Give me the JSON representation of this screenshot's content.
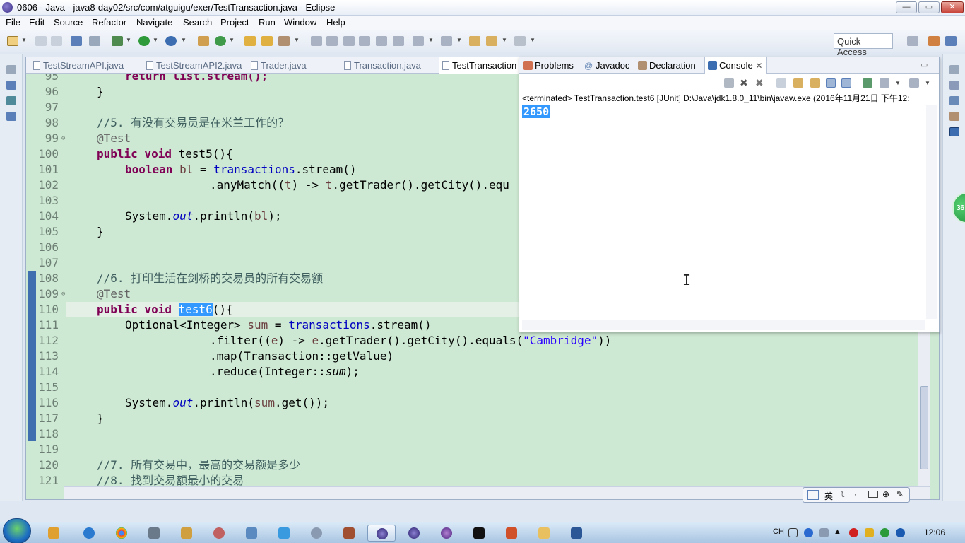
{
  "window": {
    "title": "0606 - Java - java8-day02/src/com/atguigu/exer/TestTransaction.java - Eclipse",
    "minimize_label": "—",
    "restore_label": "▭",
    "close_label": "✕"
  },
  "menu": [
    "File",
    "Edit",
    "Source",
    "Refactor",
    "Navigate",
    "Search",
    "Project",
    "Run",
    "Window",
    "Help"
  ],
  "toolbar": {
    "quick_access": "Quick Access"
  },
  "editor": {
    "tabs": [
      "TestStreamAPI.java",
      "TestStreamAPI2.java",
      "Trader.java",
      "Transaction.java",
      "TestTransaction"
    ],
    "line_numbers": [
      "95",
      "96",
      "97",
      "98",
      "99",
      "100",
      "101",
      "102",
      "103",
      "104",
      "105",
      "106",
      "107",
      "108",
      "109",
      "110",
      "111",
      "112",
      "113",
      "114",
      "115",
      "116",
      "117",
      "118",
      "119",
      "120",
      "121"
    ],
    "code": {
      "l95": "return list.stream();",
      "l96": "}",
      "l98": "//5. 有没有交易员是在米兰工作的？",
      "l99": "@Test",
      "l100_kw": "public void",
      "l100_rest": " test5(){",
      "l101_kw": "boolean",
      "l101_var": " bl",
      "l101_eq": " = ",
      "l101_field": "transactions",
      "l101_rest": ".stream()",
      "l102_a": ".anyMatch((",
      "l102_t1": "t",
      "l102_b": ") -> ",
      "l102_t2": "t",
      "l102_c": ".getTrader().getCity().equ",
      "l104_a": "System.",
      "l104_out": "out",
      "l104_b": ".println(",
      "l104_var": "bl",
      "l104_c": ");",
      "l105": "}",
      "l108": "//6. 打印生活在剑桥的交易员的所有交易额",
      "l109": "@Test",
      "l110_kw": "public void",
      "l110_sel": "test6",
      "l110_rest": "(){",
      "l111_a": "Optional<Integer> ",
      "l111_var": "sum",
      "l111_eq": " = ",
      "l111_field": "transactions",
      "l111_b": ".stream()",
      "l112_a": ".filter((",
      "l112_e1": "e",
      "l112_b": ") -> ",
      "l112_e2": "e",
      "l112_c": ".getTrader().getCity().equals(",
      "l112_str": "\"Cambridge\"",
      "l112_d": "))",
      "l113": ".map(Transaction::getValue)",
      "l114_a": ".reduce(Integer::",
      "l114_sum": "sum",
      "l114_b": ");",
      "l116_a": "System.",
      "l116_out": "out",
      "l116_b": ".println(",
      "l116_var": "sum",
      "l116_c": ".get());",
      "l117": "}",
      "l120": "//7. 所有交易中，最高的交易额是多少",
      "l121": "//8. 找到交易额最小的交易"
    }
  },
  "console_view": {
    "tabs": [
      "Problems",
      "Javadoc",
      "Declaration",
      "Console"
    ],
    "active_tab": "Console",
    "status": "<terminated> TestTransaction.test6 [JUnit] D:\\Java\\jdk1.8.0_11\\bin\\javaw.exe (2016年11月21日 下午12:",
    "output": "2650"
  },
  "ime": {
    "lang": "英"
  },
  "float_badge": "36",
  "taskbar": {
    "tray_lang": "CH",
    "clock": "12:06"
  },
  "colors": {
    "editor_bg": "#cde8d3",
    "selection": "#3399ff",
    "keyword": "#7f0055",
    "comment": "#3f5f5f",
    "field": "#0000c0",
    "string": "#2a00ff"
  }
}
